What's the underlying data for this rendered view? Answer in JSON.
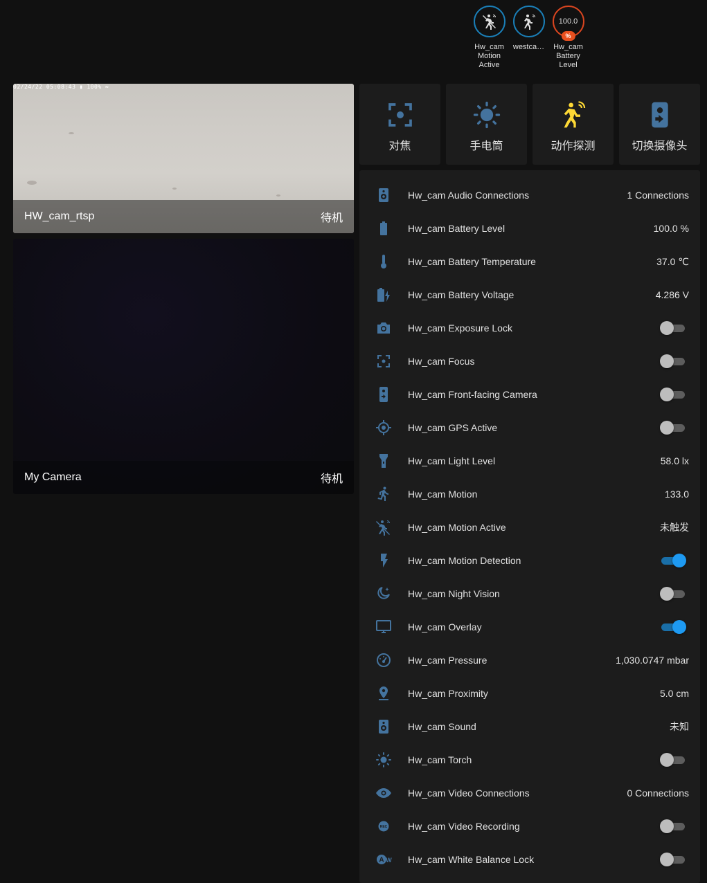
{
  "badges": [
    {
      "label": "Hw_cam Motion Active",
      "icon": "motion-sensor-off-icon",
      "value": ""
    },
    {
      "label": "westca…",
      "icon": "motion-sensor-icon",
      "value": ""
    },
    {
      "label": "Hw_cam Battery Level",
      "icon": "",
      "value": "100.0",
      "unit": "%"
    }
  ],
  "cameras": [
    {
      "name": "HW_cam_rtsp",
      "status": "待机",
      "osd": "02/24/22 05:08:43 ▮ 100% ≈"
    },
    {
      "name": "My Camera",
      "status": "待机"
    }
  ],
  "actions": [
    {
      "label": "对焦",
      "icon": "focus-icon"
    },
    {
      "label": "手电筒",
      "icon": "torch-icon"
    },
    {
      "label": "动作探测",
      "icon": "motion-detect-icon"
    },
    {
      "label": "切换摄像头",
      "icon": "switch-camera-icon"
    }
  ],
  "entities": [
    {
      "name": "Hw_cam Audio Connections",
      "icon": "speaker-icon",
      "state": "1 Connections"
    },
    {
      "name": "Hw_cam Battery Level",
      "icon": "battery-icon",
      "state": "100.0 %"
    },
    {
      "name": "Hw_cam Battery Temperature",
      "icon": "thermometer-icon",
      "state": "37.0 ℃"
    },
    {
      "name": "Hw_cam Battery Voltage",
      "icon": "battery-charging-icon",
      "state": "4.286 V"
    },
    {
      "name": "Hw_cam Exposure Lock",
      "icon": "camera-icon",
      "toggle": false
    },
    {
      "name": "Hw_cam Focus",
      "icon": "focus-icon",
      "toggle": false
    },
    {
      "name": "Hw_cam Front-facing Camera",
      "icon": "switch-camera-icon",
      "toggle": false
    },
    {
      "name": "Hw_cam GPS Active",
      "icon": "crosshairs-gps-icon",
      "toggle": false
    },
    {
      "name": "Hw_cam Light Level",
      "icon": "flashlight-icon",
      "state": "58.0 lx"
    },
    {
      "name": "Hw_cam Motion",
      "icon": "run-icon",
      "state": "133.0"
    },
    {
      "name": "Hw_cam Motion Active",
      "icon": "motion-sensor-off-icon",
      "state": "未触发"
    },
    {
      "name": "Hw_cam Motion Detection",
      "icon": "flash-icon",
      "toggle": true
    },
    {
      "name": "Hw_cam Night Vision",
      "icon": "weather-night-icon",
      "toggle": false
    },
    {
      "name": "Hw_cam Overlay",
      "icon": "monitor-icon",
      "toggle": true
    },
    {
      "name": "Hw_cam Pressure",
      "icon": "gauge-icon",
      "state": "1,030.0747 mbar"
    },
    {
      "name": "Hw_cam Proximity",
      "icon": "map-marker-icon",
      "state": "5.0 cm"
    },
    {
      "name": "Hw_cam Sound",
      "icon": "speaker-icon",
      "state": "未知"
    },
    {
      "name": "Hw_cam Torch",
      "icon": "torch-icon",
      "toggle": false
    },
    {
      "name": "Hw_cam Video Connections",
      "icon": "eye-icon",
      "state": "0 Connections"
    },
    {
      "name": "Hw_cam Video Recording",
      "icon": "record-rec-icon",
      "toggle": false
    },
    {
      "name": "Hw_cam White Balance Lock",
      "icon": "white-balance-auto-icon",
      "toggle": false
    }
  ],
  "colors": {
    "icon": "#44739e",
    "accent": "#1e9af2",
    "warning": "#fdd835",
    "battery_badge": "#e8501f"
  }
}
